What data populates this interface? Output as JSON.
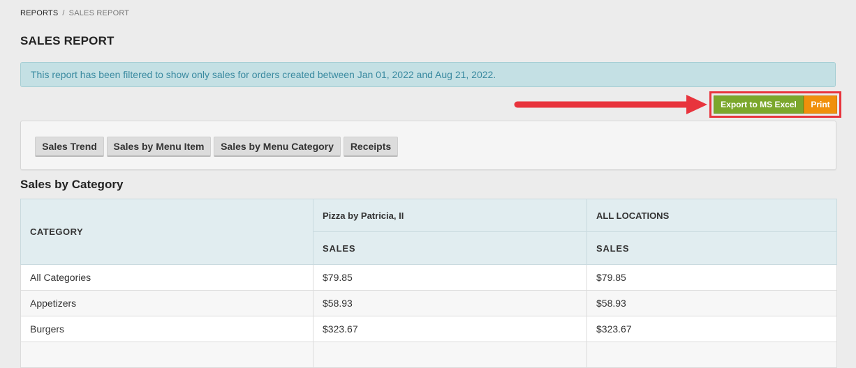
{
  "breadcrumb": {
    "parent": "REPORTS",
    "separator": "/",
    "current": "SALES REPORT"
  },
  "page_title": "SALES REPORT",
  "filter_notice": "This report has been filtered to show only sales for orders created between Jan 01, 2022 and Aug 21, 2022.",
  "export": {
    "excel_label": "Export to MS Excel",
    "print_label": "Print",
    "highlight_color": "#e8343d"
  },
  "report_tabs": [
    {
      "label": "Sales Trend"
    },
    {
      "label": "Sales by Menu Item"
    },
    {
      "label": "Sales by Menu Category"
    },
    {
      "label": "Receipts"
    }
  ],
  "section_title": "Sales by Category",
  "table": {
    "category_header": "CATEGORY",
    "locations": [
      {
        "name": "Pizza by Patricia, II",
        "sub_header": "SALES"
      },
      {
        "name": "ALL LOCATIONS",
        "sub_header": "SALES"
      }
    ],
    "rows": [
      {
        "category": "All Categories",
        "values": [
          "$79.85",
          "$79.85"
        ]
      },
      {
        "category": "Appetizers",
        "values": [
          "$58.93",
          "$58.93"
        ]
      },
      {
        "category": "Burgers",
        "values": [
          "$323.67",
          "$323.67"
        ]
      },
      {
        "category": "",
        "values": [
          "",
          ""
        ]
      }
    ]
  },
  "colors": {
    "alert_bg": "#c4e0e4",
    "alert_text": "#3a8aa0",
    "excel_button": "#7ba72c",
    "print_button": "#f0900c",
    "table_header_bg": "#e1edf0"
  }
}
